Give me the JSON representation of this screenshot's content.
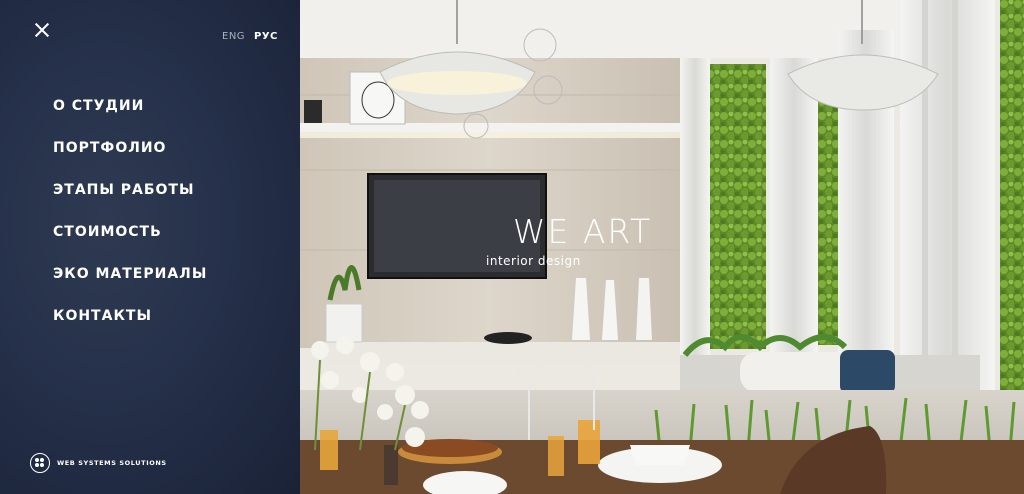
{
  "sidebar": {
    "close": "close-icon",
    "languages": [
      {
        "label": "ENG",
        "active": false
      },
      {
        "label": "РУС",
        "active": true
      }
    ],
    "menu": [
      {
        "label": "О СТУДИИ"
      },
      {
        "label": "ПОРТФОЛИО"
      },
      {
        "label": "ЭТАПЫ РАБОТЫ"
      },
      {
        "label": "СТОИМОСТЬ"
      },
      {
        "label": "ЭКО МАТЕРИАЛЫ"
      },
      {
        "label": "КОНТАКТЫ"
      }
    ],
    "footer": {
      "text": "WEB SYSTEMS SOLUTIONS"
    }
  },
  "hero": {
    "title": "WE ART",
    "subtitle": "interior design"
  },
  "colors": {
    "sidebar_bg": "#25304a",
    "text": "#ffffff",
    "moss": "#6e9a2e"
  }
}
